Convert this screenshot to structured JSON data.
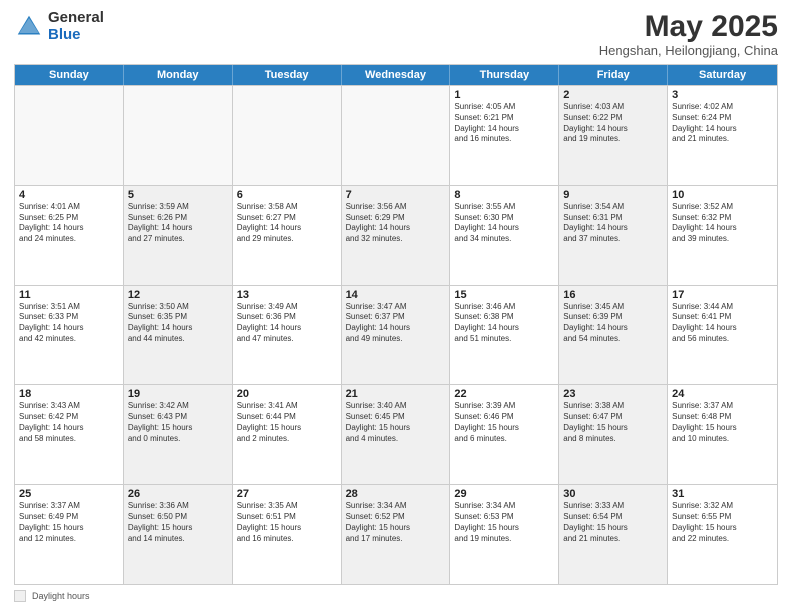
{
  "logo": {
    "general": "General",
    "blue": "Blue"
  },
  "title": "May 2025",
  "location": "Hengshan, Heilongjiang, China",
  "header_days": [
    "Sunday",
    "Monday",
    "Tuesday",
    "Wednesday",
    "Thursday",
    "Friday",
    "Saturday"
  ],
  "weeks": [
    [
      {
        "day": "",
        "text": "",
        "shaded": true,
        "empty": true
      },
      {
        "day": "",
        "text": "",
        "shaded": true,
        "empty": true
      },
      {
        "day": "",
        "text": "",
        "shaded": true,
        "empty": true
      },
      {
        "day": "",
        "text": "",
        "shaded": true,
        "empty": true
      },
      {
        "day": "1",
        "text": "Sunrise: 4:05 AM\nSunset: 6:21 PM\nDaylight: 14 hours\nand 16 minutes.",
        "shaded": false
      },
      {
        "day": "2",
        "text": "Sunrise: 4:03 AM\nSunset: 6:22 PM\nDaylight: 14 hours\nand 19 minutes.",
        "shaded": true
      },
      {
        "day": "3",
        "text": "Sunrise: 4:02 AM\nSunset: 6:24 PM\nDaylight: 14 hours\nand 21 minutes.",
        "shaded": false
      }
    ],
    [
      {
        "day": "4",
        "text": "Sunrise: 4:01 AM\nSunset: 6:25 PM\nDaylight: 14 hours\nand 24 minutes.",
        "shaded": false
      },
      {
        "day": "5",
        "text": "Sunrise: 3:59 AM\nSunset: 6:26 PM\nDaylight: 14 hours\nand 27 minutes.",
        "shaded": true
      },
      {
        "day": "6",
        "text": "Sunrise: 3:58 AM\nSunset: 6:27 PM\nDaylight: 14 hours\nand 29 minutes.",
        "shaded": false
      },
      {
        "day": "7",
        "text": "Sunrise: 3:56 AM\nSunset: 6:29 PM\nDaylight: 14 hours\nand 32 minutes.",
        "shaded": true
      },
      {
        "day": "8",
        "text": "Sunrise: 3:55 AM\nSunset: 6:30 PM\nDaylight: 14 hours\nand 34 minutes.",
        "shaded": false
      },
      {
        "day": "9",
        "text": "Sunrise: 3:54 AM\nSunset: 6:31 PM\nDaylight: 14 hours\nand 37 minutes.",
        "shaded": true
      },
      {
        "day": "10",
        "text": "Sunrise: 3:52 AM\nSunset: 6:32 PM\nDaylight: 14 hours\nand 39 minutes.",
        "shaded": false
      }
    ],
    [
      {
        "day": "11",
        "text": "Sunrise: 3:51 AM\nSunset: 6:33 PM\nDaylight: 14 hours\nand 42 minutes.",
        "shaded": false
      },
      {
        "day": "12",
        "text": "Sunrise: 3:50 AM\nSunset: 6:35 PM\nDaylight: 14 hours\nand 44 minutes.",
        "shaded": true
      },
      {
        "day": "13",
        "text": "Sunrise: 3:49 AM\nSunset: 6:36 PM\nDaylight: 14 hours\nand 47 minutes.",
        "shaded": false
      },
      {
        "day": "14",
        "text": "Sunrise: 3:47 AM\nSunset: 6:37 PM\nDaylight: 14 hours\nand 49 minutes.",
        "shaded": true
      },
      {
        "day": "15",
        "text": "Sunrise: 3:46 AM\nSunset: 6:38 PM\nDaylight: 14 hours\nand 51 minutes.",
        "shaded": false
      },
      {
        "day": "16",
        "text": "Sunrise: 3:45 AM\nSunset: 6:39 PM\nDaylight: 14 hours\nand 54 minutes.",
        "shaded": true
      },
      {
        "day": "17",
        "text": "Sunrise: 3:44 AM\nSunset: 6:41 PM\nDaylight: 14 hours\nand 56 minutes.",
        "shaded": false
      }
    ],
    [
      {
        "day": "18",
        "text": "Sunrise: 3:43 AM\nSunset: 6:42 PM\nDaylight: 14 hours\nand 58 minutes.",
        "shaded": false
      },
      {
        "day": "19",
        "text": "Sunrise: 3:42 AM\nSunset: 6:43 PM\nDaylight: 15 hours\nand 0 minutes.",
        "shaded": true
      },
      {
        "day": "20",
        "text": "Sunrise: 3:41 AM\nSunset: 6:44 PM\nDaylight: 15 hours\nand 2 minutes.",
        "shaded": false
      },
      {
        "day": "21",
        "text": "Sunrise: 3:40 AM\nSunset: 6:45 PM\nDaylight: 15 hours\nand 4 minutes.",
        "shaded": true
      },
      {
        "day": "22",
        "text": "Sunrise: 3:39 AM\nSunset: 6:46 PM\nDaylight: 15 hours\nand 6 minutes.",
        "shaded": false
      },
      {
        "day": "23",
        "text": "Sunrise: 3:38 AM\nSunset: 6:47 PM\nDaylight: 15 hours\nand 8 minutes.",
        "shaded": true
      },
      {
        "day": "24",
        "text": "Sunrise: 3:37 AM\nSunset: 6:48 PM\nDaylight: 15 hours\nand 10 minutes.",
        "shaded": false
      }
    ],
    [
      {
        "day": "25",
        "text": "Sunrise: 3:37 AM\nSunset: 6:49 PM\nDaylight: 15 hours\nand 12 minutes.",
        "shaded": false
      },
      {
        "day": "26",
        "text": "Sunrise: 3:36 AM\nSunset: 6:50 PM\nDaylight: 15 hours\nand 14 minutes.",
        "shaded": true
      },
      {
        "day": "27",
        "text": "Sunrise: 3:35 AM\nSunset: 6:51 PM\nDaylight: 15 hours\nand 16 minutes.",
        "shaded": false
      },
      {
        "day": "28",
        "text": "Sunrise: 3:34 AM\nSunset: 6:52 PM\nDaylight: 15 hours\nand 17 minutes.",
        "shaded": true
      },
      {
        "day": "29",
        "text": "Sunrise: 3:34 AM\nSunset: 6:53 PM\nDaylight: 15 hours\nand 19 minutes.",
        "shaded": false
      },
      {
        "day": "30",
        "text": "Sunrise: 3:33 AM\nSunset: 6:54 PM\nDaylight: 15 hours\nand 21 minutes.",
        "shaded": true
      },
      {
        "day": "31",
        "text": "Sunrise: 3:32 AM\nSunset: 6:55 PM\nDaylight: 15 hours\nand 22 minutes.",
        "shaded": false
      }
    ]
  ],
  "footer": {
    "box_label": "Daylight hours"
  }
}
